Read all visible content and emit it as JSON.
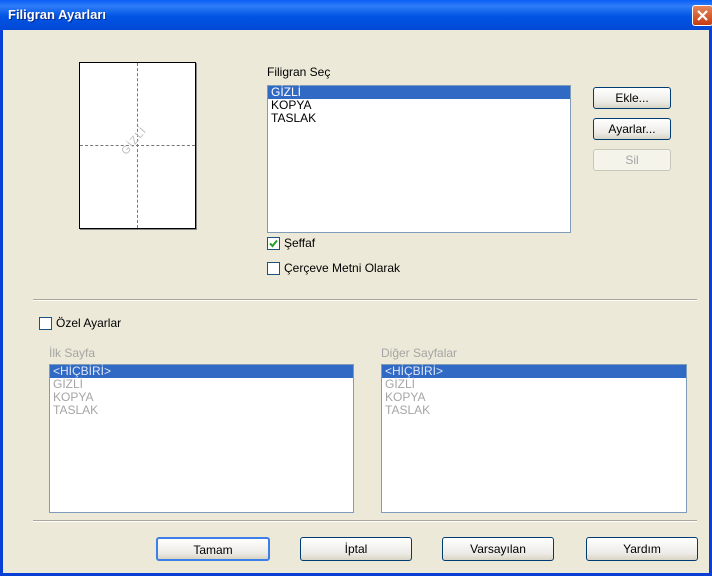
{
  "window": {
    "title": "Filigran Ayarları"
  },
  "watermark_list": {
    "label": "Filigran Seç",
    "items": [
      "GİZLİ",
      "KOPYA",
      "TASLAK"
    ],
    "selected": "GİZLİ"
  },
  "preview": {
    "watermark_text": "GİZLİ"
  },
  "buttons": {
    "add": "Ekle...",
    "settings": "Ayarlar...",
    "delete": "Sil"
  },
  "options": {
    "transparent": {
      "label": "Şeffaf",
      "checked": true
    },
    "outline_text": {
      "label": "Çerçeve Metni Olarak",
      "checked": false
    },
    "custom_settings": {
      "label": "Özel Ayarlar",
      "checked": false
    }
  },
  "first_page": {
    "label": "İlk Sayfa",
    "items": [
      "<HİÇBİRİ>",
      "GİZLİ",
      "KOPYA",
      "TASLAK"
    ],
    "selected": "<HİÇBİRİ>"
  },
  "other_pages": {
    "label": "Diğer Sayfalar",
    "items": [
      "<HİÇBİRİ>",
      "GİZLİ",
      "KOPYA",
      "TASLAK"
    ],
    "selected": "<HİÇBİRİ>"
  },
  "footer": {
    "ok": "Tamam",
    "cancel": "İptal",
    "defaults": "Varsayılan",
    "help": "Yardım"
  }
}
